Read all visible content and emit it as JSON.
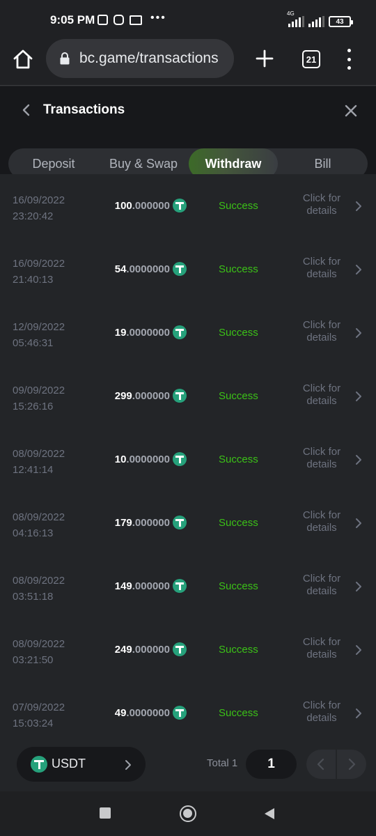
{
  "status_bar": {
    "time": "9:05 PM",
    "network": "4G",
    "battery": "43"
  },
  "browser": {
    "url": "bc.game/transactions",
    "tab_count": "21"
  },
  "header": {
    "title": "Transactions"
  },
  "tabs": [
    {
      "label": "Deposit",
      "active": false
    },
    {
      "label": "Buy & Swap",
      "active": false
    },
    {
      "label": "Withdraw",
      "active": true
    },
    {
      "label": "Bill",
      "active": false
    }
  ],
  "transactions": [
    {
      "date": "16/09/2022",
      "time": "23:20:42",
      "amount_int": "100",
      "amount_dec": ".000000",
      "status": "Success",
      "details": "Click for details"
    },
    {
      "date": "16/09/2022",
      "time": "21:40:13",
      "amount_int": "54",
      "amount_dec": ".0000000",
      "status": "Success",
      "details": "Click for details"
    },
    {
      "date": "12/09/2022",
      "time": "05:46:31",
      "amount_int": "19",
      "amount_dec": ".0000000",
      "status": "Success",
      "details": "Click for details"
    },
    {
      "date": "09/09/2022",
      "time": "15:26:16",
      "amount_int": "299",
      "amount_dec": ".000000",
      "status": "Success",
      "details": "Click for details"
    },
    {
      "date": "08/09/2022",
      "time": "12:41:14",
      "amount_int": "10",
      "amount_dec": ".0000000",
      "status": "Success",
      "details": "Click for details"
    },
    {
      "date": "08/09/2022",
      "time": "04:16:13",
      "amount_int": "179",
      "amount_dec": ".000000",
      "status": "Success",
      "details": "Click for details"
    },
    {
      "date": "08/09/2022",
      "time": "03:51:18",
      "amount_int": "149",
      "amount_dec": ".000000",
      "status": "Success",
      "details": "Click for details"
    },
    {
      "date": "08/09/2022",
      "time": "03:21:50",
      "amount_int": "249",
      "amount_dec": ".000000",
      "status": "Success",
      "details": "Click for details"
    },
    {
      "date": "07/09/2022",
      "time": "15:03:24",
      "amount_int": "49",
      "amount_dec": ".0000000",
      "status": "Success",
      "details": "Click for details"
    }
  ],
  "footer": {
    "currency": "USDT",
    "total_label": "Total 1",
    "page": "1"
  },
  "colors": {
    "accent_green": "#3bc117",
    "tether": "#26a17b",
    "background": "#232528",
    "header_bg": "#17181b"
  },
  "icons": {
    "coin": "tether-icon",
    "row_action": "chevron-right-icon"
  }
}
